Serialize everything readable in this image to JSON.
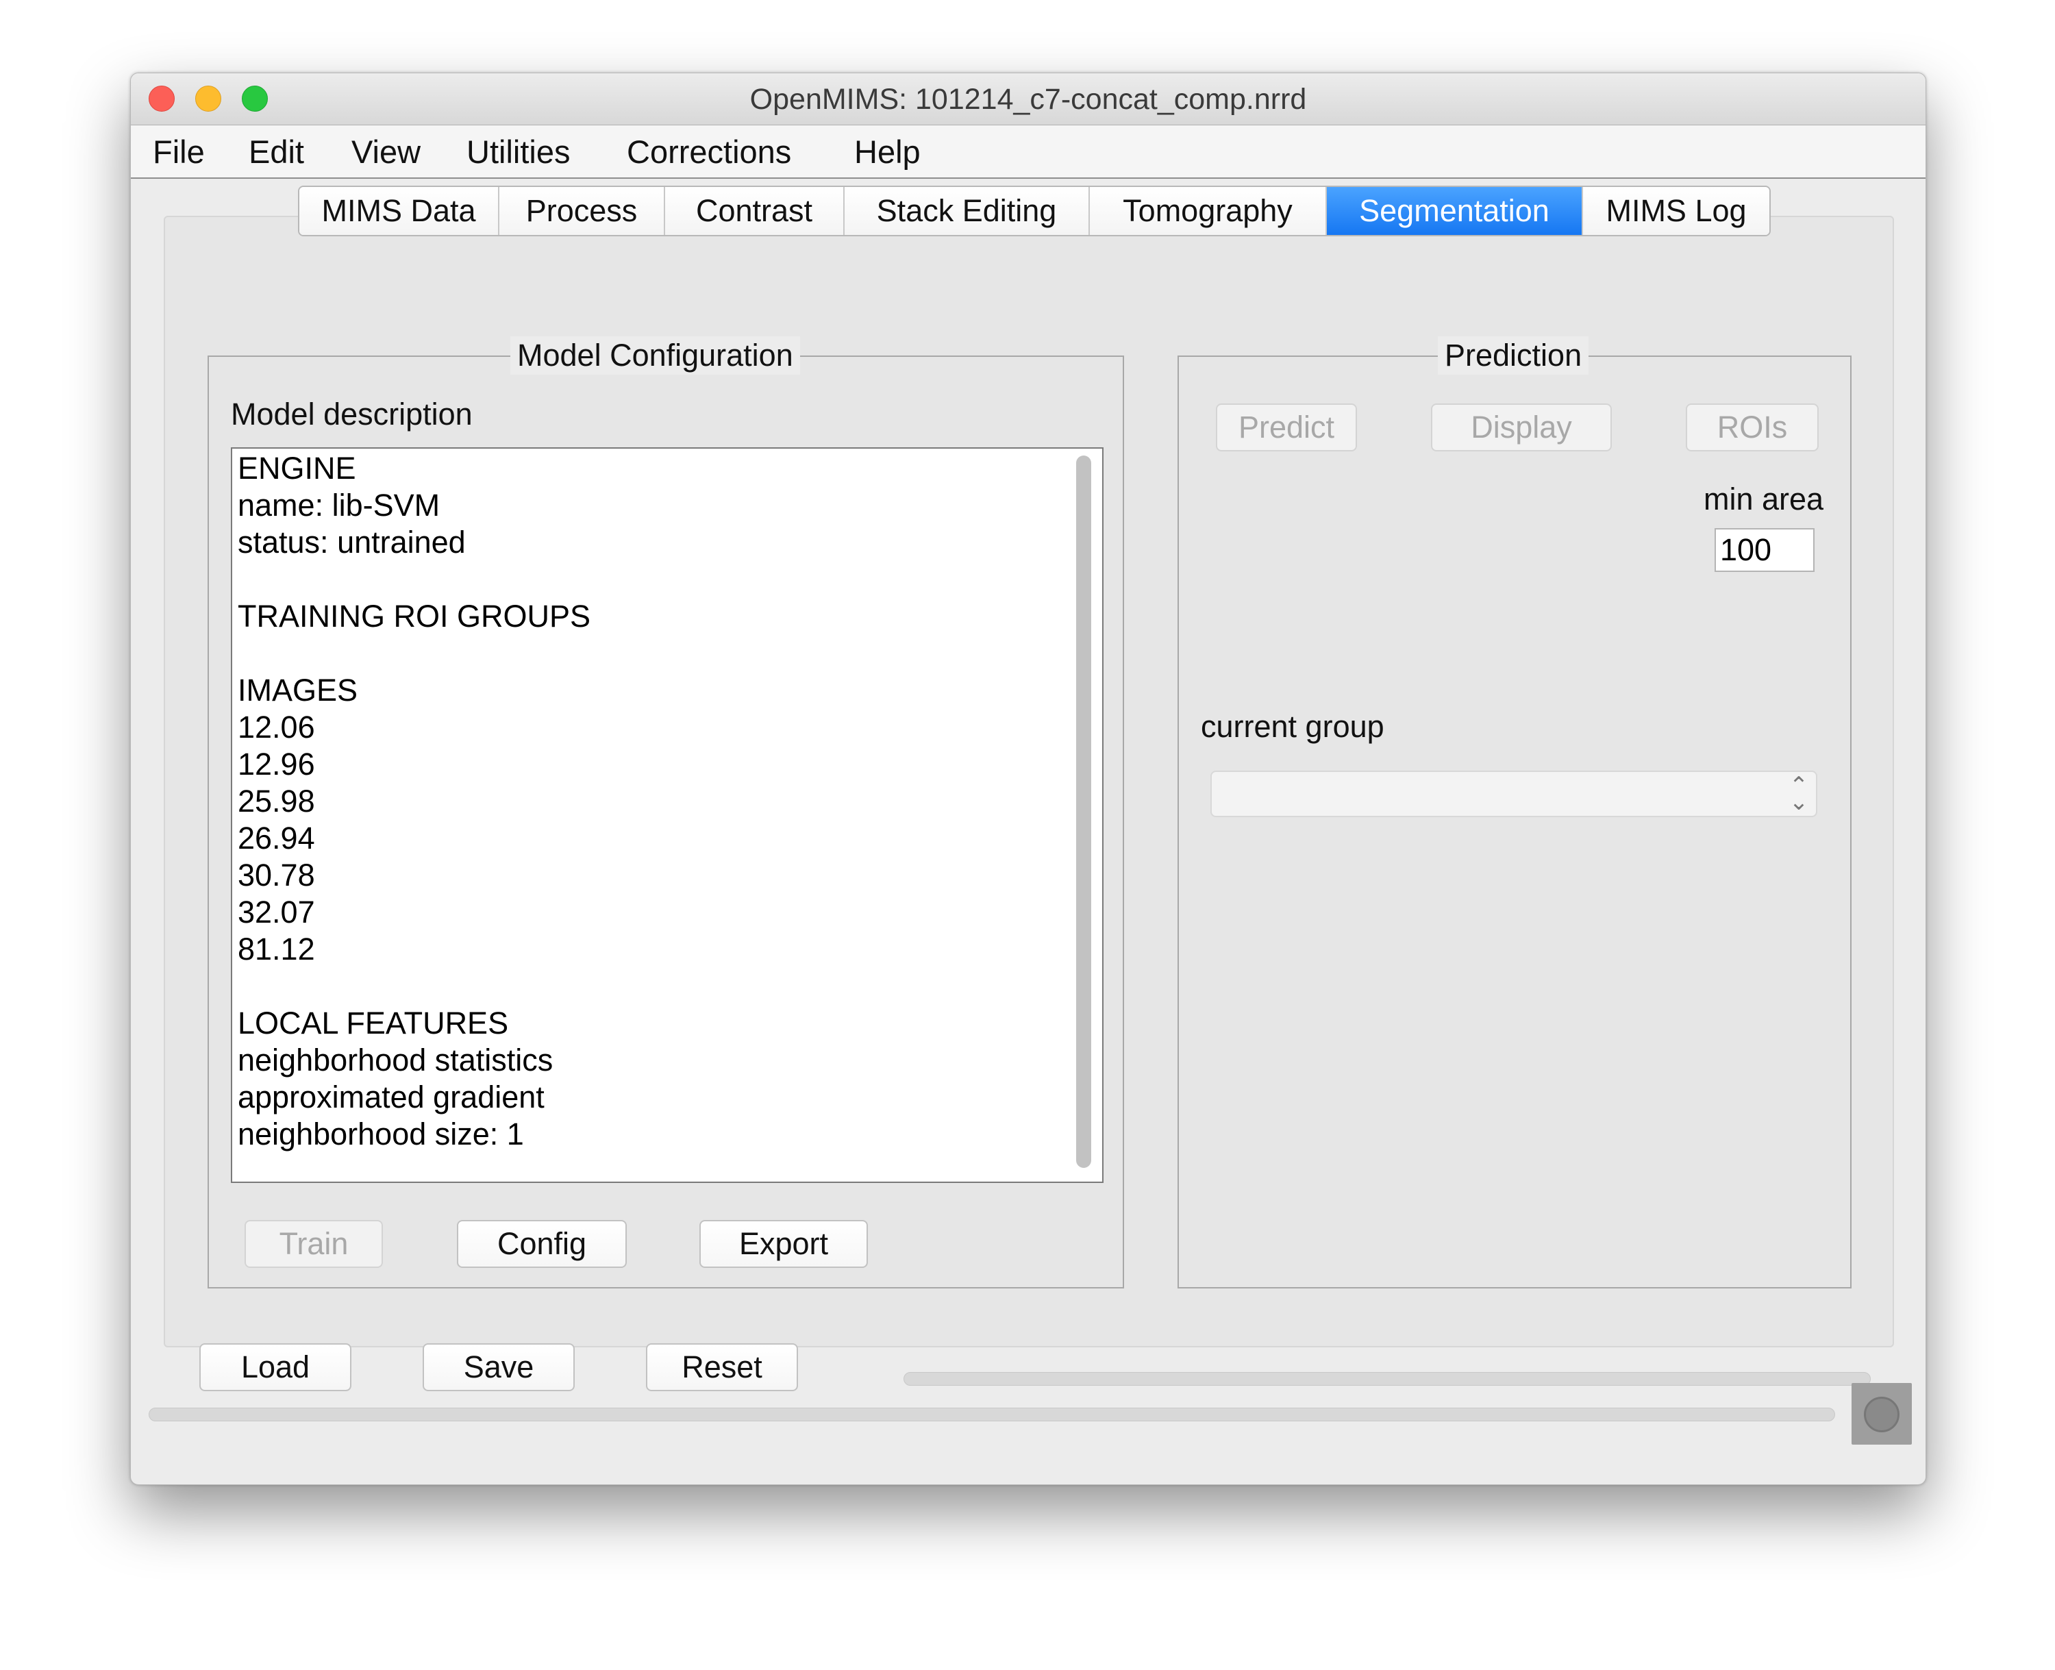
{
  "window": {
    "title": "OpenMIMS: 101214_c7-concat_comp.nrrd"
  },
  "menu": [
    "File",
    "Edit",
    "View",
    "Utilities",
    "Corrections",
    "Help"
  ],
  "tabs": [
    {
      "label": "MIMS Data"
    },
    {
      "label": "Process"
    },
    {
      "label": "Contrast"
    },
    {
      "label": "Stack Editing"
    },
    {
      "label": "Tomography"
    },
    {
      "label": "Segmentation",
      "selected": true
    },
    {
      "label": "MIMS Log"
    }
  ],
  "model_config": {
    "legend": "Model Configuration",
    "description_label": "Model description",
    "description_lines": [
      "ENGINE",
      "name: lib-SVM",
      "status: untrained",
      "",
      "TRAINING ROI GROUPS",
      "",
      "IMAGES",
      "12.06",
      "12.96",
      "25.98",
      "26.94",
      "30.78",
      "32.07",
      "81.12",
      "",
      "LOCAL FEATURES",
      "neighborhood statistics",
      "approximated gradient",
      "neighborhood size: 1"
    ],
    "buttons": {
      "train": {
        "label": "Train",
        "enabled": false
      },
      "config": {
        "label": "Config",
        "enabled": true
      },
      "export": {
        "label": "Export",
        "enabled": true
      }
    }
  },
  "prediction": {
    "legend": "Prediction",
    "buttons": {
      "predict": {
        "label": "Predict",
        "enabled": false
      },
      "display": {
        "label": "Display",
        "enabled": false
      },
      "rois": {
        "label": "ROIs",
        "enabled": false
      }
    },
    "min_area_label": "min area",
    "min_area_value": "100",
    "current_group_label": "current group",
    "current_group_value": ""
  },
  "bottom_buttons": {
    "load": "Load",
    "save": "Save",
    "reset": "Reset"
  },
  "colors": {
    "selected_tab": "#1677f2",
    "window_bg": "#ececec",
    "close": "#fc5f57",
    "minimize": "#fdbc2e",
    "zoom": "#28c840"
  }
}
